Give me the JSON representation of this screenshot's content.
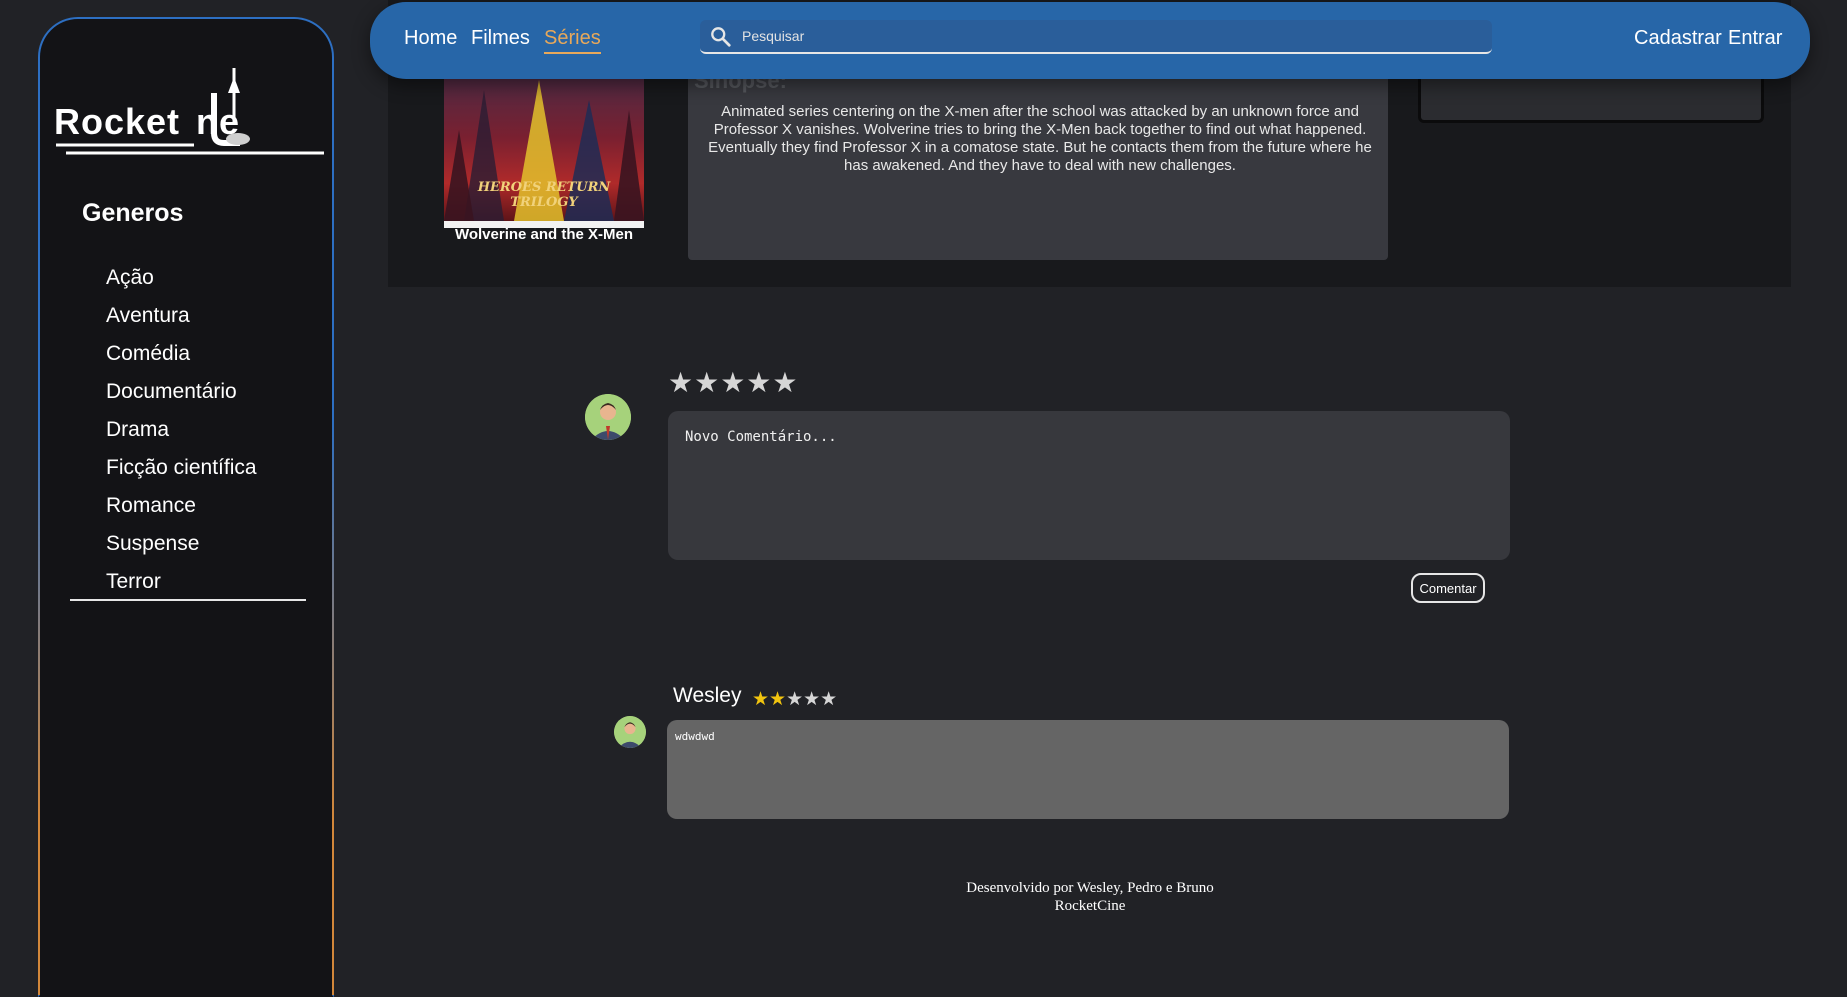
{
  "logo": {
    "part1": "Rocket",
    "part2": "ne"
  },
  "sidebar": {
    "title": "Generos",
    "genres": [
      "Ação",
      "Aventura",
      "Comédia",
      "Documentário",
      "Drama",
      "Ficção científica",
      "Romance",
      "Suspense",
      "Terror"
    ]
  },
  "nav": {
    "links": [
      "Home",
      "Filmes",
      "Séries"
    ],
    "active": "Séries",
    "search_placeholder": "Pesquisar",
    "register": "Cadastrar",
    "login": "Entrar"
  },
  "series": {
    "title": "Wolverine and the X-Men",
    "poster_text": "HEROES RETURN TRILOGY",
    "synopsis_heading": "Sinopse:",
    "synopsis": "Animated series centering on the X-men after the school was attacked by an unknown force and Professor X vanishes. Wolverine tries to bring the X-Men back together to find out what happened. Eventually they find Professor X in a comatose state. But he contacts them from the future where he has awakened. And they have to deal with new challenges."
  },
  "composer": {
    "stars": "★★★★★",
    "placeholder": "Novo Comentário...",
    "button": "Comentar"
  },
  "comments": [
    {
      "author": "Wesley",
      "rating": 2,
      "max": 5,
      "stars_on": "★★",
      "stars_off": "★★★",
      "text": "wdwdwd"
    }
  ],
  "footer": {
    "line1": "Desenvolvido por Wesley, Pedro e Bruno",
    "line2": "RocketCine"
  },
  "colors": {
    "nav": "#2766a8",
    "accent": "#e7a85a",
    "star": "#f1c40f"
  }
}
